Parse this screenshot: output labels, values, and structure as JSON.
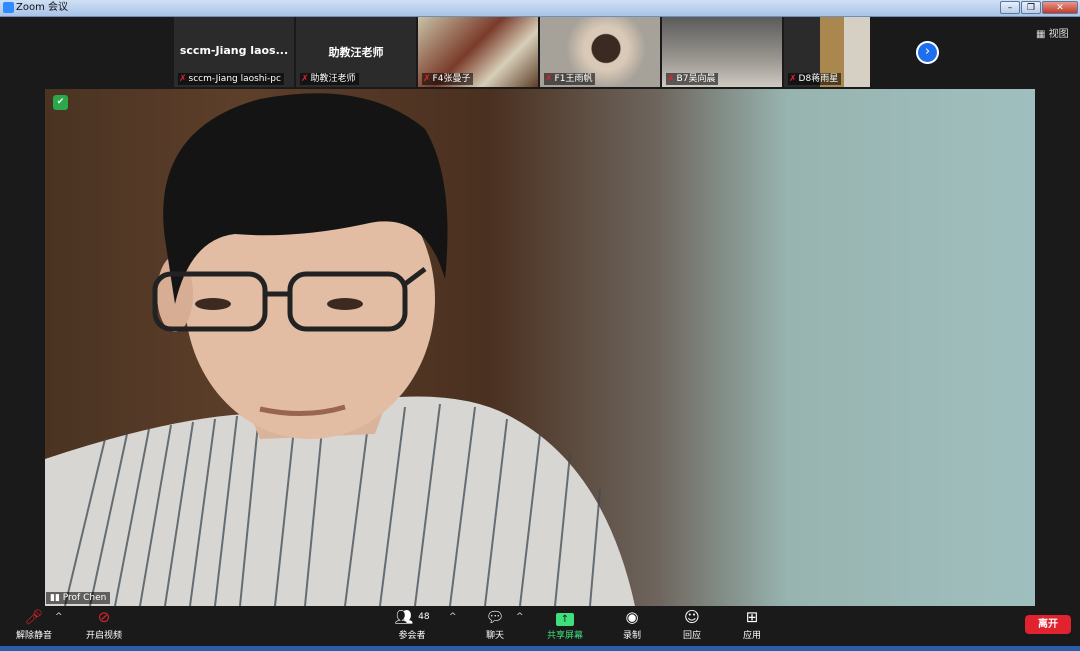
{
  "window": {
    "title": "Zoom 会议"
  },
  "view_button": "视图",
  "participants": [
    {
      "big_name": "sccm-Jiang  laos...",
      "label": "sccm-Jiang laoshi-pc"
    },
    {
      "big_name": "助教汪老师",
      "label": "助教汪老师"
    },
    {
      "label": "F4张曼子"
    },
    {
      "label": "F1王雨帆"
    },
    {
      "label": "B7吴向晨"
    },
    {
      "label": "D8蒋雨星"
    }
  ],
  "speaker": {
    "name": "Prof Chen"
  },
  "toolbar": {
    "unmute": "解除静音",
    "start_video": "开启视频",
    "participants": "参会者",
    "participant_count": "48",
    "chat": "聊天",
    "share_screen": "共享屏幕",
    "record": "录制",
    "reactions": "回应",
    "apps": "应用",
    "leave": "离开"
  },
  "colors": {
    "leave": "#e0232e",
    "share": "#3fe07b",
    "accent": "#1e6ff0"
  }
}
